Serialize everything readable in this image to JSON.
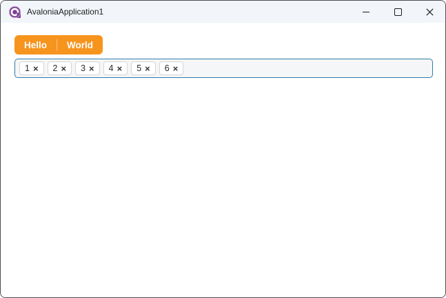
{
  "window": {
    "title": "AvaloniaApplication1",
    "app_icon": "avalonia-logo",
    "controls": {
      "minimize": "minimize",
      "maximize": "maximize",
      "close": "close"
    }
  },
  "tabs": {
    "items": [
      {
        "label": "Hello",
        "selected": true
      },
      {
        "label": "World",
        "selected": false
      }
    ]
  },
  "chips": {
    "items": [
      {
        "label": "1"
      },
      {
        "label": "2"
      },
      {
        "label": "3"
      },
      {
        "label": "4"
      },
      {
        "label": "5"
      },
      {
        "label": "6"
      }
    ],
    "remove_glyph": "×"
  },
  "colors": {
    "accent_orange": "#F7941E",
    "focus_border_blue": "#3579A8",
    "chips_track_background": "#F4F6F7",
    "titlebar_background": "#F2F6FA",
    "logo_purple": "#7E3F98",
    "window_border": "#4B4B4E"
  }
}
